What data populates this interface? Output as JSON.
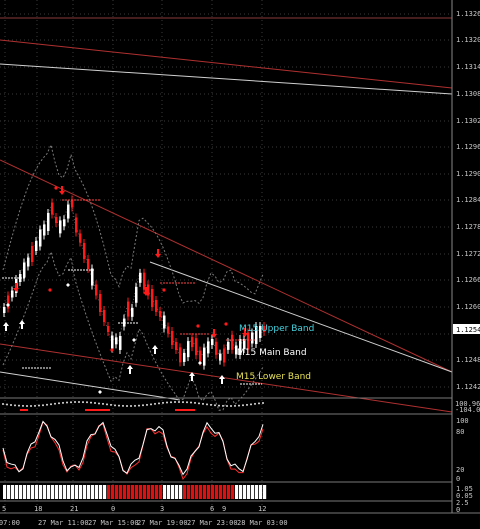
{
  "colors": {
    "background": "#000000",
    "grid": "#3a3a3a",
    "bull": "#ffffff",
    "bear": "#ff1a1a",
    "band": "#7a7a7a",
    "trend_red": "#c03030",
    "trend_white": "#d0d0d0",
    "upper_band_label": "#46d3e0",
    "main_band_label": "#ffffff",
    "lower_band_label": "#e6e05a",
    "price_tag_bg": "#ffffff"
  },
  "price_axis": {
    "labels": [
      "1.1326",
      "1.1320",
      "1.1314",
      "1.1308",
      "1.1302",
      "1.1296",
      "1.1290",
      "1.1284",
      "1.1278",
      "1.1272",
      "1.1266",
      "1.1260",
      "1.1254",
      "1.1248",
      "1.1242"
    ],
    "current_price": "1.1254"
  },
  "band_labels": {
    "upper": "M15 Upper Band",
    "main": "M15 Main Band",
    "lower": "M15 Lower Band"
  },
  "indicator_panel_1": {
    "labels": [
      "100.962",
      "-104.05"
    ]
  },
  "indicator_panel_2": {
    "labels": [
      "100",
      "80",
      "20",
      "0"
    ]
  },
  "indicator_panel_3": {
    "labels": [
      "1.05",
      "0.05",
      "2.5",
      "0"
    ]
  },
  "time_axis": {
    "labels": [
      "5",
      "18",
      "21",
      "27 Mar 11:00",
      "0",
      "27 Mar 15:00",
      "3",
      "27 Mar 19:00",
      "6",
      "27 Mar 23:00",
      "9",
      "28 Mar 03:00",
      "12"
    ],
    "left_partial": "Mar 07:00"
  }
}
